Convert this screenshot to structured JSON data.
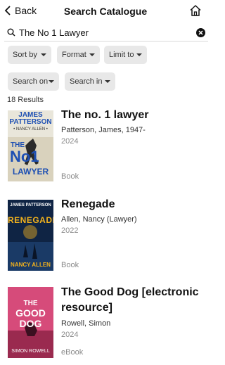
{
  "header": {
    "back_label": "Back",
    "title": "Search Catalogue"
  },
  "search": {
    "query": "The No 1 Lawyer"
  },
  "filters": [
    {
      "label": "Sort by"
    },
    {
      "label": "Format"
    },
    {
      "label": "Limit to"
    },
    {
      "label": "Search on"
    },
    {
      "label": "Search in"
    }
  ],
  "results_count": "18 Results",
  "results": [
    {
      "title": "The no. 1 lawyer",
      "author": "Patterson, James, 1947-",
      "year": "2024",
      "format": "Book",
      "cover": {
        "line1": "JAMES",
        "line2": "PATTERSON",
        "line3": "• NANCY ALLEN •",
        "line4": "THE",
        "line5": "No1",
        "line6": "LAWYER"
      }
    },
    {
      "title": "Renegade",
      "author": "Allen, Nancy (Lawyer)",
      "year": "2022",
      "format": "Book",
      "cover": {
        "line1": "JAMES PATTERSON",
        "line2": "RENEGADE",
        "line3": "NANCY ALLEN"
      }
    },
    {
      "title": "The Good Dog [electronic resource]",
      "author": "Rowell, Simon",
      "year": "2024",
      "format": "eBook",
      "cover": {
        "line1": "THE",
        "line2": "GOOD",
        "line3": "DOG",
        "line4": "SIMON ROWELL"
      }
    }
  ],
  "colors": {
    "chip_bg": "#e8e8e8",
    "cover1_bg": "#e9e6da",
    "cover1_accent": "#1d4fb3",
    "cover2_bg": "#0f2444",
    "cover2_accent": "#f2b21d",
    "cover3_bg": "#d64b7a"
  }
}
